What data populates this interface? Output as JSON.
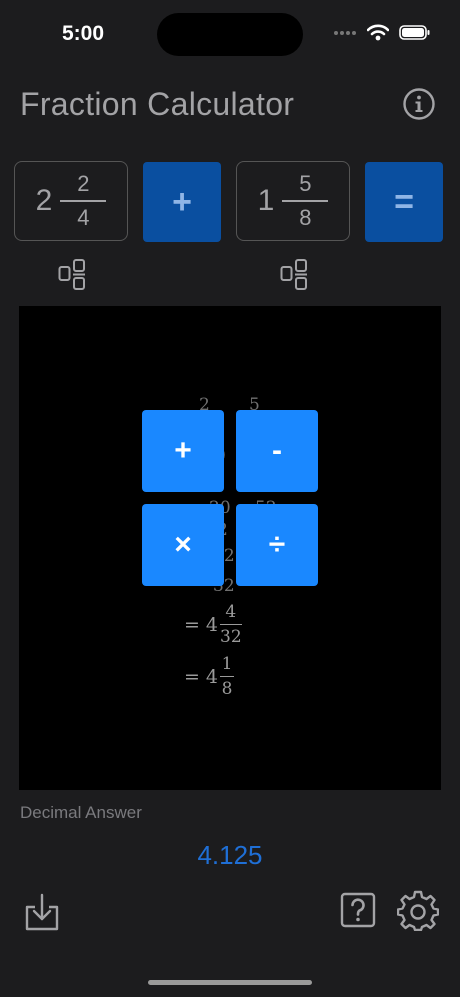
{
  "status_bar": {
    "time": "5:00"
  },
  "header": {
    "title": "Fraction Calculator"
  },
  "input": {
    "left_fraction": {
      "whole": "2",
      "numerator": "2",
      "denominator": "4"
    },
    "operator": "+",
    "right_fraction": {
      "whole": "1",
      "numerator": "5",
      "denominator": "8"
    },
    "equals": "="
  },
  "work": {
    "lines": [
      {
        "prefix": "=",
        "whole": "4",
        "numerator": "4",
        "denominator": "32"
      },
      {
        "prefix": "=",
        "whole": "4",
        "numerator": "1",
        "denominator": "8"
      }
    ],
    "obscured_fragments": [
      "2",
      "5",
      "0",
      "20",
      "52",
      "2",
      "32",
      "32"
    ]
  },
  "operator_popup": {
    "add": "+",
    "subtract": "-",
    "multiply": "×",
    "divide": "÷"
  },
  "decimal": {
    "label": "Decimal Answer",
    "value": "4.125"
  },
  "icons": {
    "info": "info-circle-icon",
    "mixed_left": "mixed-number-icon",
    "mixed_right": "mixed-number-icon",
    "export": "download-tray-icon",
    "help": "help-question-icon",
    "settings": "gear-icon"
  },
  "colors": {
    "accent": "#1a88ff",
    "dark_button": "#0a4fa0",
    "decimal_value": "#1f6fd6"
  }
}
